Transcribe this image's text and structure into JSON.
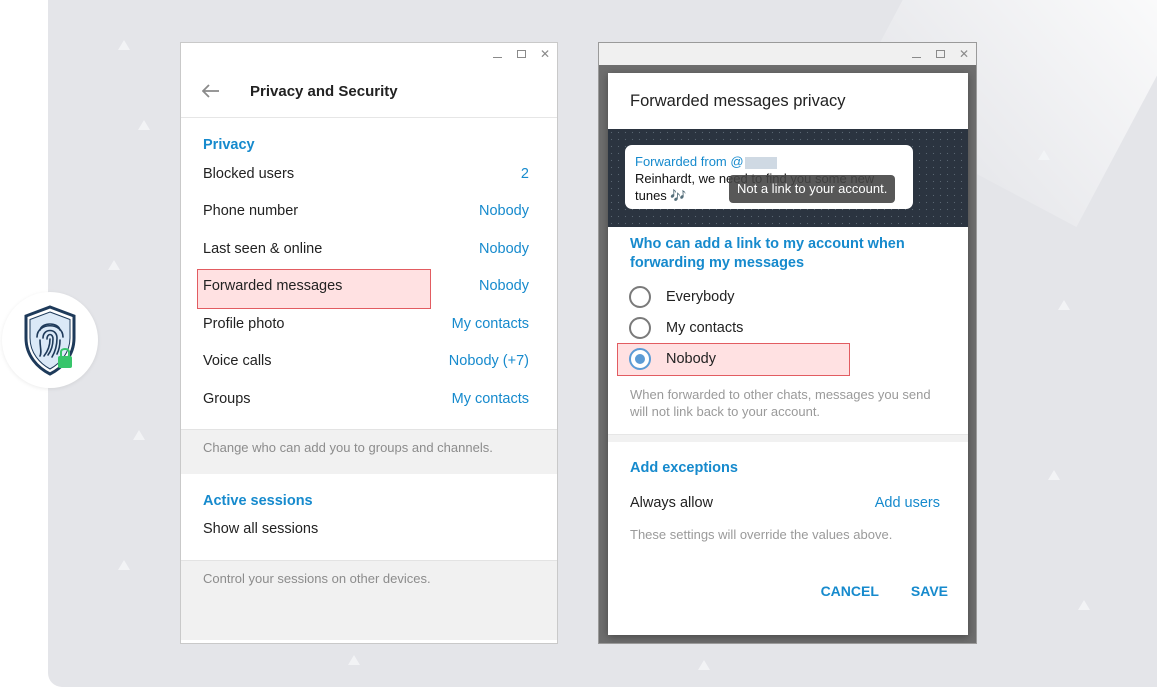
{
  "left_window": {
    "header_title": "Privacy and Security",
    "privacy": {
      "title": "Privacy",
      "rows": [
        {
          "label": "Blocked users",
          "value": "2"
        },
        {
          "label": "Phone number",
          "value": "Nobody"
        },
        {
          "label": "Last seen & online",
          "value": "Nobody"
        },
        {
          "label": "Forwarded messages",
          "value": "Nobody"
        },
        {
          "label": "Profile photo",
          "value": "My contacts"
        },
        {
          "label": "Voice calls",
          "value": "Nobody (+7)"
        },
        {
          "label": "Groups",
          "value": "My contacts"
        }
      ],
      "note": "Change who can add you to groups and channels."
    },
    "sessions": {
      "title": "Active sessions",
      "show_all": "Show all sessions",
      "note": "Control your sessions on other devices."
    }
  },
  "dialog": {
    "title": "Forwarded messages privacy",
    "preview": {
      "from_label": "Forwarded from @",
      "message": "Reinhardt, we need to find you some new tunes 🎶",
      "tooltip": "Not a link to your account."
    },
    "question": "Who can add a link to my account when forwarding my messages",
    "options": [
      {
        "label": "Everybody",
        "selected": false
      },
      {
        "label": "My contacts",
        "selected": false
      },
      {
        "label": "Nobody",
        "selected": true
      }
    ],
    "hint": "When forwarded to other chats, messages you send will not link back to your account.",
    "exceptions_title": "Add exceptions",
    "always_allow_label": "Always allow",
    "add_users_label": "Add users",
    "override_hint": "These settings will override the values above.",
    "cancel_label": "CANCEL",
    "save_label": "SAVE"
  },
  "colors": {
    "accent": "#168acd",
    "highlight_border": "#e25c61",
    "radio_selected": "#5b9bd5"
  }
}
